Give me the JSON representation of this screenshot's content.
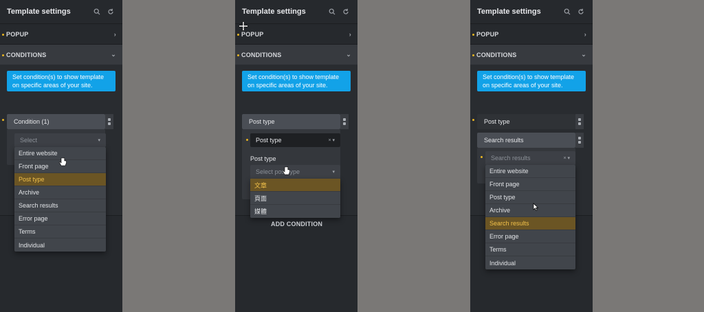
{
  "panels": [
    {
      "header": {
        "title": "Template settings"
      },
      "sections": {
        "popup": "POPUP",
        "conditions": "CONDITIONS"
      },
      "info": "Set condition(s) to show template on specific areas of your site.",
      "condition_label": "Condition (1)",
      "select": {
        "placeholder": "Select"
      },
      "menu": [
        "Entire website",
        "Front page",
        "Post type",
        "Archive",
        "Search results",
        "Error page",
        "Terms",
        "Individual"
      ],
      "highlighted": "Post type"
    },
    {
      "header": {
        "title": "Template settings"
      },
      "sections": {
        "popup": "POPUP",
        "conditions": "CONDITIONS"
      },
      "info": "Set condition(s) to show template on specific areas of your site.",
      "condition_label": "Post type",
      "select": {
        "value": "Post type"
      },
      "sub_label": "Post type",
      "sub_select": {
        "placeholder": "Select post type"
      },
      "menu": [
        "文章",
        "頁面",
        "媒體"
      ],
      "highlighted": "文章",
      "add_condition": "ADD CONDITION"
    },
    {
      "header": {
        "title": "Template settings"
      },
      "sections": {
        "popup": "POPUP",
        "conditions": "CONDITIONS"
      },
      "info": "Set condition(s) to show template on specific areas of your site.",
      "condition_label": "Post type",
      "condition2_label": "Search results",
      "select": {
        "value": "Search results"
      },
      "menu": [
        "Entire website",
        "Front page",
        "Post type",
        "Archive",
        "Search results",
        "Error page",
        "Terms",
        "Individual"
      ],
      "highlighted": "Search results"
    }
  ],
  "colors": {
    "accent": "#12a2e8",
    "highlight": "#f2c14a",
    "dot": "#e8b422"
  }
}
